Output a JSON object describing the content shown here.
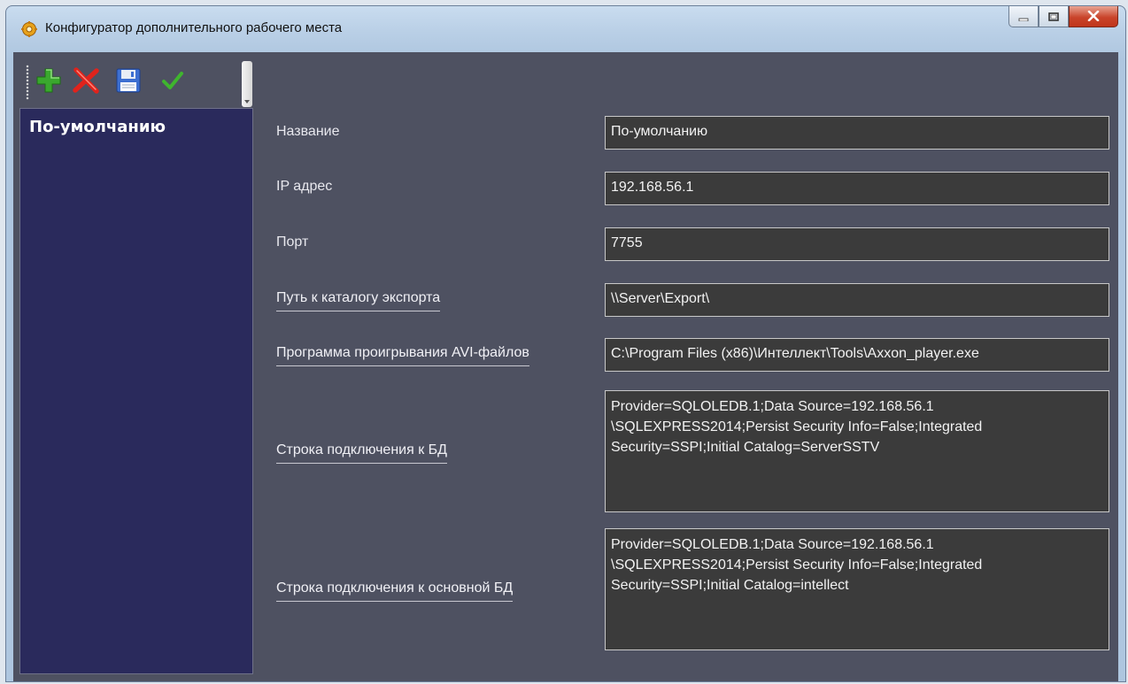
{
  "window": {
    "title": "Конфигуратор дополнительного рабочего места",
    "icon": "gear-icon",
    "caption_buttons": [
      "minimize-icon",
      "maximize-icon",
      "close-icon"
    ]
  },
  "toolbar": {
    "buttons": [
      {
        "name": "add",
        "icon": "plus-icon",
        "color": "#3aa82e"
      },
      {
        "name": "delete",
        "icon": "cross-icon",
        "color": "#e0231c"
      },
      {
        "name": "save",
        "icon": "floppy-disk-icon",
        "color": "#3d6fd1"
      },
      {
        "name": "apply",
        "icon": "checkmark-icon",
        "color": "#3fb52e"
      }
    ]
  },
  "profiles": {
    "items": [
      "По-умолчанию"
    ],
    "selected": "По-умолчанию"
  },
  "form": {
    "name": {
      "label": "Название",
      "value": "По-умолчанию"
    },
    "ip": {
      "label": "IP адрес",
      "value": "192.168.56.1"
    },
    "port": {
      "label": "Порт",
      "value": "7755"
    },
    "export_path": {
      "label": "Путь к каталогу экспорта",
      "value": "\\\\Server\\Export\\"
    },
    "avi_player": {
      "label": "Программа проигрывания AVI-файлов",
      "value": "C:\\Program Files (x86)\\Интеллект\\Tools\\Axxon_player.exe"
    },
    "db_conn": {
      "label": "Строка подключения к БД",
      "value": "Provider=SQLOLEDB.1;Data Source=192.168.56.1\n\\SQLEXPRESS2014;Persist Security Info=False;Integrated\nSecurity=SSPI;Initial Catalog=ServerSSTV"
    },
    "main_db_conn": {
      "label": "Строка подключения к основной БД",
      "value": "Provider=SQLOLEDB.1;Data Source=192.168.56.1\n\\SQLEXPRESS2014;Persist Security Info=False;Integrated\nSecurity=SSPI;Initial Catalog=intellect"
    }
  },
  "colors": {
    "client_bg": "#4e5161",
    "list_bg": "#2a2a5c",
    "field_bg": "#3b3b3b"
  }
}
